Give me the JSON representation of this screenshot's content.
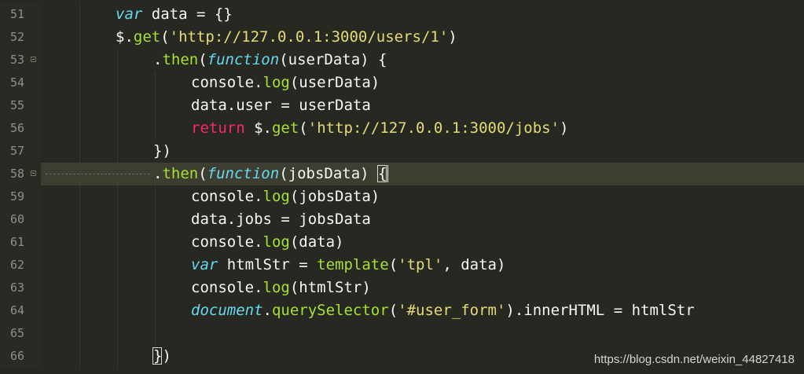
{
  "editor": {
    "lines": [
      {
        "number": "51",
        "tokens": [
          [
            "kw",
            "var"
          ],
          [
            "p",
            " data = {}"
          ]
        ]
      },
      {
        "number": "52",
        "tokens": [
          [
            "p",
            "$."
          ],
          [
            "fn",
            "get"
          ],
          [
            "p",
            "("
          ],
          [
            "str",
            "'http://127.0.0.1:3000/users/1'"
          ],
          [
            "p",
            ")"
          ]
        ]
      },
      {
        "number": "53",
        "tokens": [
          [
            "p",
            "."
          ],
          [
            "fn",
            "then"
          ],
          [
            "p",
            "("
          ],
          [
            "kw",
            "function"
          ],
          [
            "p",
            "(userData) {"
          ]
        ]
      },
      {
        "number": "54",
        "tokens": [
          [
            "p",
            "console."
          ],
          [
            "fn",
            "log"
          ],
          [
            "p",
            "(userData)"
          ]
        ]
      },
      {
        "number": "55",
        "tokens": [
          [
            "p",
            "data.user = userData"
          ]
        ]
      },
      {
        "number": "56",
        "tokens": [
          [
            "ret",
            "return"
          ],
          [
            "p",
            " $."
          ],
          [
            "fn",
            "get"
          ],
          [
            "p",
            "("
          ],
          [
            "str",
            "'http://127.0.0.1:3000/jobs'"
          ],
          [
            "p",
            ")"
          ]
        ]
      },
      {
        "number": "57",
        "tokens": [
          [
            "p",
            "})"
          ]
        ]
      },
      {
        "number": "58",
        "tokens": [
          [
            "p",
            "."
          ],
          [
            "fn",
            "then"
          ],
          [
            "p",
            "("
          ],
          [
            "kw",
            "function"
          ],
          [
            "p",
            "(jobsData) {"
          ]
        ]
      },
      {
        "number": "59",
        "tokens": [
          [
            "p",
            "console."
          ],
          [
            "fn",
            "log"
          ],
          [
            "p",
            "(jobsData)"
          ]
        ]
      },
      {
        "number": "60",
        "tokens": [
          [
            "p",
            "data.jobs = jobsData"
          ]
        ]
      },
      {
        "number": "61",
        "tokens": [
          [
            "p",
            "console."
          ],
          [
            "fn",
            "log"
          ],
          [
            "p",
            "(data)"
          ]
        ]
      },
      {
        "number": "62",
        "tokens": [
          [
            "kw",
            "var"
          ],
          [
            "p",
            " htmlStr = "
          ],
          [
            "fn",
            "template"
          ],
          [
            "p",
            "("
          ],
          [
            "str",
            "'tpl'"
          ],
          [
            "p",
            ", data)"
          ]
        ]
      },
      {
        "number": "63",
        "tokens": [
          [
            "p",
            "console."
          ],
          [
            "fn",
            "log"
          ],
          [
            "p",
            "(htmlStr)"
          ]
        ]
      },
      {
        "number": "64",
        "tokens": [
          [
            "kw",
            "document"
          ],
          [
            "p",
            "."
          ],
          [
            "fn",
            "querySelector"
          ],
          [
            "p",
            "("
          ],
          [
            "str",
            "'#user_form'"
          ],
          [
            "p",
            ").innerHTML = htmlStr"
          ]
        ]
      },
      {
        "number": "65",
        "tokens": []
      },
      {
        "number": "66",
        "tokens": [
          [
            "p",
            "})"
          ]
        ]
      }
    ],
    "fold_markers": [
      "53",
      "58"
    ],
    "current_line": "58",
    "colors": {
      "background": "#272822",
      "keyword": "#66d9ef",
      "return": "#f92672",
      "function": "#a6e22e",
      "string": "#e6db74",
      "plain": "#f8f8f2"
    }
  },
  "watermark": "https://blog.csdn.net/weixin_44827418"
}
